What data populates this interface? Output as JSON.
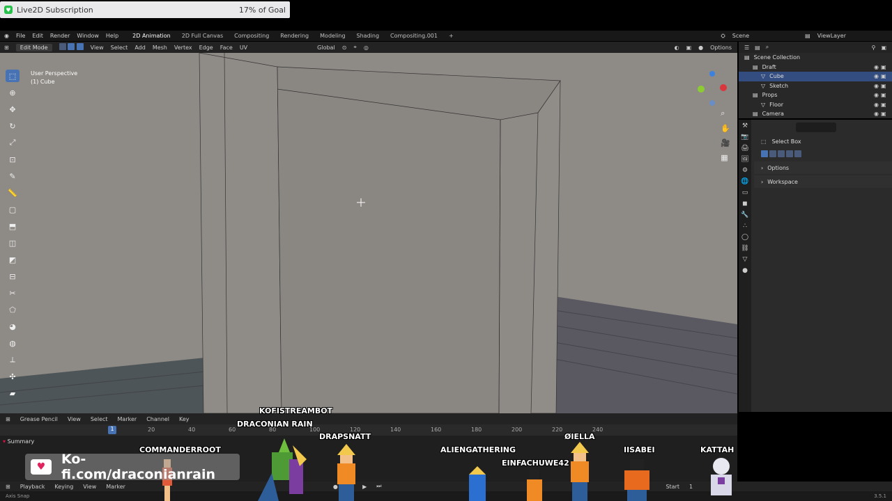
{
  "overlay": {
    "subscription_title": "Live2D Subscription",
    "subscription_goal": "17% of Goal",
    "kofi_url": "Ko-fi.com/draconianrain",
    "viewer_names": [
      "KOFISTREAMBOT",
      "DRACONIAN RAIN",
      "DRAPSNATT",
      "COMMANDERROOT",
      "ALIENGATHERING",
      "ØIELLA",
      "EINFACHUWE42",
      "IISABEI",
      "KATTAH"
    ]
  },
  "menu": {
    "items": [
      "File",
      "Edit",
      "Render",
      "Window",
      "Help"
    ],
    "workspaces": [
      "2D Animation",
      "2D Full Canvas",
      "Compositing",
      "Rendering",
      "Modeling",
      "Shading",
      "Compositing.001",
      "+"
    ],
    "scene": "Scene",
    "view_layer": "ViewLayer"
  },
  "viewport_header": {
    "mode": "Edit Mode",
    "menus": [
      "View",
      "Select",
      "Add",
      "Mesh",
      "Vertex",
      "Edge",
      "Face",
      "UV"
    ],
    "orientation": "Global",
    "options": "Options",
    "axes": "X Y Z"
  },
  "viewport": {
    "perspective_label": "User Perspective",
    "object_label": "(1) Cube"
  },
  "outliner": {
    "rows": [
      {
        "name": "Scene Collection",
        "indent": 0,
        "selected": false
      },
      {
        "name": "Draft",
        "indent": 1,
        "selected": false
      },
      {
        "name": "Cube",
        "indent": 2,
        "selected": true
      },
      {
        "name": "Sketch",
        "indent": 2,
        "selected": false
      },
      {
        "name": "Props",
        "indent": 1,
        "selected": false
      },
      {
        "name": "Floor",
        "indent": 2,
        "selected": false
      },
      {
        "name": "Camera",
        "indent": 1,
        "selected": false
      }
    ]
  },
  "properties": {
    "tool_name": "Select Box",
    "panels": [
      "Options",
      "Workspace"
    ]
  },
  "timeline": {
    "mode": "Grease Pencil",
    "menus": [
      "View",
      "Select",
      "Marker",
      "Channel",
      "Key"
    ],
    "ticks": [
      "20",
      "40",
      "60",
      "80",
      "100",
      "120",
      "140",
      "160",
      "180",
      "200",
      "220",
      "240"
    ],
    "current_frame": "1",
    "summary": "Summary",
    "footer_menus": [
      "Playback",
      "Keying",
      "View",
      "Marker"
    ],
    "start_label": "Start",
    "start_value": "1"
  },
  "status": {
    "hint": "Axis Snap",
    "version": "3.5.1"
  }
}
